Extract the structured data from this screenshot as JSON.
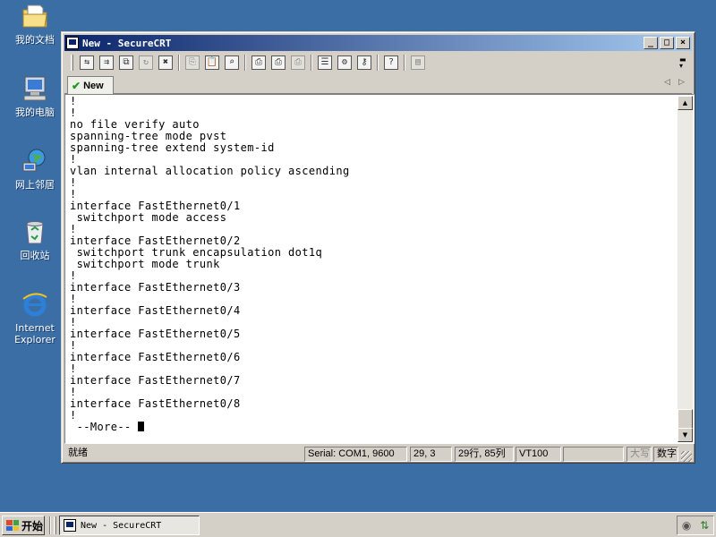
{
  "desktop": {
    "icons": [
      {
        "label": "我的文档"
      },
      {
        "label": "我的电脑"
      },
      {
        "label": "网上邻居"
      },
      {
        "label": "回收站"
      },
      {
        "label": "Internet Explorer"
      }
    ]
  },
  "window": {
    "title": "New - SecureCRT",
    "controls": {
      "minimize": "_",
      "maximize": "□",
      "close": "×"
    }
  },
  "toolbar": {
    "buttons": [
      {
        "icon": "connect-icon",
        "glyph": "⇆",
        "enabled": true
      },
      {
        "icon": "quick-connect-icon",
        "glyph": "⇉",
        "enabled": true
      },
      {
        "icon": "connect-tab-icon",
        "glyph": "⧉",
        "enabled": true
      },
      {
        "icon": "reconnect-icon",
        "glyph": "↻",
        "enabled": false
      },
      {
        "icon": "disconnect-icon",
        "glyph": "✖",
        "enabled": true
      },
      {
        "icon": "copy-icon",
        "glyph": "⎘",
        "enabled": false
      },
      {
        "icon": "paste-icon",
        "glyph": "📋",
        "enabled": true
      },
      {
        "icon": "find-icon",
        "glyph": "⌕",
        "enabled": true
      },
      {
        "icon": "print-icon",
        "glyph": "⎙",
        "enabled": true
      },
      {
        "icon": "print-selection-icon",
        "glyph": "⎙",
        "enabled": true
      },
      {
        "icon": "print-setup-icon",
        "glyph": "⎙",
        "enabled": false
      },
      {
        "icon": "session-options-icon",
        "glyph": "☰",
        "enabled": true
      },
      {
        "icon": "global-options-icon",
        "glyph": "⚙",
        "enabled": true
      },
      {
        "icon": "keymap-icon",
        "glyph": "⚷",
        "enabled": true
      },
      {
        "icon": "help-icon",
        "glyph": "?",
        "enabled": true
      },
      {
        "icon": "sftp-icon",
        "glyph": "▤",
        "enabled": false
      }
    ]
  },
  "tabs": [
    {
      "label": "New"
    }
  ],
  "terminal": {
    "lines": [
      "!",
      "!",
      "no file verify auto",
      "spanning-tree mode pvst",
      "spanning-tree extend system-id",
      "!",
      "vlan internal allocation policy ascending",
      "!",
      "!",
      "interface FastEthernet0/1",
      " switchport mode access",
      "!",
      "interface FastEthernet0/2",
      " switchport trunk encapsulation dot1q",
      " switchport mode trunk",
      "!",
      "interface FastEthernet0/3",
      "!",
      "interface FastEthernet0/4",
      "!",
      "interface FastEthernet0/5",
      "!",
      "interface FastEthernet0/6",
      "!",
      "interface FastEthernet0/7",
      "!",
      "interface FastEthernet0/8",
      "!"
    ],
    "prompt": " --More-- "
  },
  "status": {
    "ready": "就绪",
    "connection": "Serial: COM1, 9600",
    "cursor_pos": "29,  3",
    "size": "29行, 85列",
    "emulation": "VT100",
    "blank": "",
    "caps": "大写",
    "num": "数字"
  },
  "taskbar": {
    "start_label": "开始",
    "task_label": "New - SecureCRT"
  }
}
